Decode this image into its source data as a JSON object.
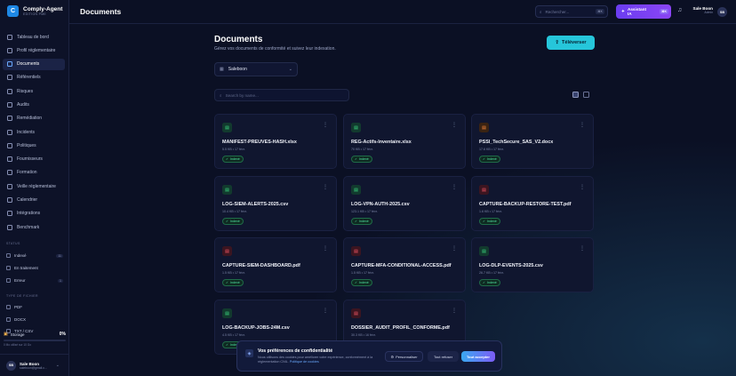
{
  "app": {
    "name": "Comply-Agent",
    "edition": "EDITION PME",
    "logo_letter": "C"
  },
  "sidebar": {
    "items": [
      {
        "label": "Tableau de bord",
        "icon": "dashboard-icon",
        "active": false
      },
      {
        "label": "Profil réglementaire",
        "icon": "shield-icon",
        "active": false
      },
      {
        "label": "Documents",
        "icon": "document-icon",
        "active": true
      },
      {
        "label": "Référentiels",
        "icon": "book-icon",
        "active": false
      },
      {
        "label": "Risques",
        "icon": "alert-icon",
        "active": false
      },
      {
        "label": "Audits",
        "icon": "clipboard-icon",
        "active": false
      },
      {
        "label": "Remédiation",
        "icon": "wrench-icon",
        "active": false
      },
      {
        "label": "Incidents",
        "icon": "siren-icon",
        "active": false
      },
      {
        "label": "Politiques",
        "icon": "file-text-icon",
        "active": false
      },
      {
        "label": "Fournisseurs",
        "icon": "building-icon",
        "active": false
      },
      {
        "label": "Formation",
        "icon": "graduation-icon",
        "active": false
      },
      {
        "label": "Veille réglementaire",
        "icon": "radar-icon",
        "active": false
      },
      {
        "label": "Calendrier",
        "icon": "calendar-icon",
        "active": false
      },
      {
        "label": "Intégrations",
        "icon": "plug-icon",
        "active": false
      },
      {
        "label": "Benchmark",
        "icon": "chart-icon",
        "active": false
      }
    ],
    "status_section": "STATUS",
    "status_filters": [
      {
        "label": "Indexé",
        "count": "11"
      },
      {
        "label": "En traitement",
        "count": ""
      },
      {
        "label": "Erreur",
        "count": "1"
      }
    ],
    "type_section": "TYPE DE FICHIER",
    "type_filters": [
      {
        "label": "PDF"
      },
      {
        "label": "DOCX"
      },
      {
        "label": "TXT / CSV"
      }
    ],
    "storage": {
      "label": "Storage",
      "percent": "0%",
      "fill": 0.0,
      "note": "0 Mo utilisé sur 10 Go"
    },
    "user": {
      "initials": "SB",
      "name": "Sale Boon",
      "email": "saleboon@gmail.c..."
    }
  },
  "topbar": {
    "title": "Documents",
    "search_placeholder": "Rechercher...",
    "search_shortcut": "⌘K",
    "ai_label": "Assistant IA",
    "ai_shortcut": "⌘K",
    "user_name": "Sale Boon",
    "user_role": "Admin",
    "user_initials": "SB"
  },
  "page": {
    "title": "Documents",
    "subtitle": "Gérez vos documents de conformité et suivez leur indexation.",
    "upload_label": "Téléverser",
    "org_select": "Saleboon",
    "search_placeholder": "Search by name..."
  },
  "documents": [
    {
      "name": "MANIFEST-PREUVES-HASH.xlsx",
      "meta": "5.5 KB • 17 févr.",
      "type": "xlsx",
      "status": "Indexé"
    },
    {
      "name": "REG-Actifs-Inventaire.xlsx",
      "meta": "70 KB • 17 févr.",
      "type": "xlsx",
      "status": "Indexé"
    },
    {
      "name": "PSSI_TechSecure_SAS_V2.docx",
      "meta": "17.6 KB • 17 févr.",
      "type": "docx",
      "status": "Indexé"
    },
    {
      "name": "LOG-SIEM-ALERTS-2025.csv",
      "meta": "10.4 KB • 17 févr.",
      "type": "csv",
      "status": "Indexé"
    },
    {
      "name": "LOG-VPN-AUTH-2025.csv",
      "meta": "123.1 KB • 17 févr.",
      "type": "csv",
      "status": "Indexé"
    },
    {
      "name": "CAPTURE-BACKUP-RESTORE-TEST.pdf",
      "meta": "1.6 KB • 17 févr.",
      "type": "pdf",
      "status": "Indexé"
    },
    {
      "name": "CAPTURE-SIEM-DASHBOARD.pdf",
      "meta": "1.5 KB • 17 févr.",
      "type": "pdf",
      "status": "Indexé"
    },
    {
      "name": "CAPTURE-MFA-CONDITIONAL-ACCESS.pdf",
      "meta": "1.5 KB • 17 févr.",
      "type": "pdf",
      "status": "Indexé"
    },
    {
      "name": "LOG-DLP-EVENTS-2025.csv",
      "meta": "26.7 KB • 17 févr.",
      "type": "csv",
      "status": "Indexé"
    },
    {
      "name": "LOG-BACKUP-JOBS-24M.csv",
      "meta": "4.5 KB • 17 févr.",
      "type": "csv",
      "status": "Indexé"
    },
    {
      "name": "DOSSIER_AUDIT_PROFIL_CONFORME.pdf",
      "meta": "30.3 KB • 16 févr.",
      "type": "pdf",
      "status": ""
    }
  ],
  "cookie": {
    "title": "Vos préférences de confidentialité",
    "description": "Nous utilisons des cookies pour améliorer votre expérience, conformément à la réglementation CNIL.",
    "link": "Politique de cookies",
    "customize_label": "Personnaliser",
    "refuse_label": "Tout refuser",
    "accept_label": "Tout accepter"
  },
  "colors": {
    "accent": "#26c6da",
    "ai": "#7c4df2",
    "indexed": "#4fe0a0"
  }
}
